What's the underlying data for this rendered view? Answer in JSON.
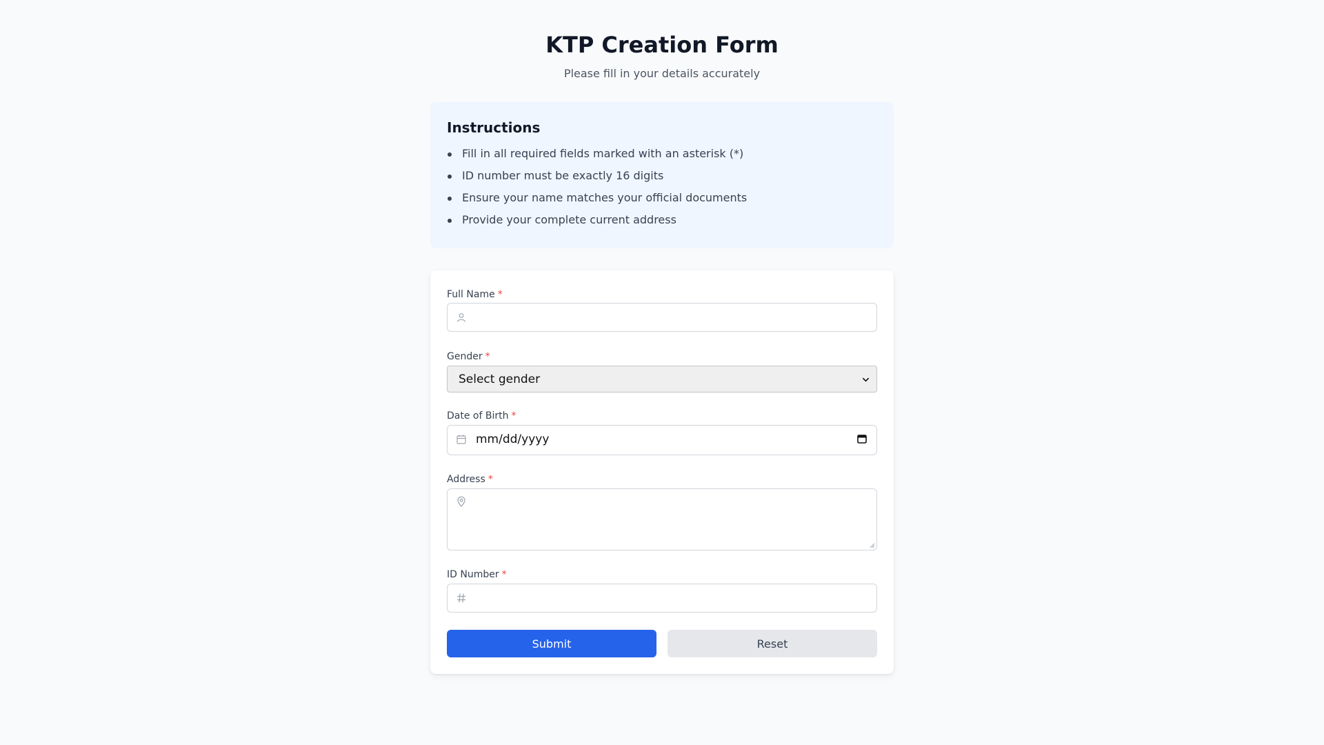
{
  "header": {
    "title": "KTP Creation Form",
    "subtitle": "Please fill in your details accurately"
  },
  "instructions": {
    "heading": "Instructions",
    "items": [
      "Fill in all required fields marked with an asterisk (*)",
      "ID number must be exactly 16 digits",
      "Ensure your name matches your official documents",
      "Provide your complete current address"
    ]
  },
  "form": {
    "full_name": {
      "label": "Full Name",
      "required_mark": "*",
      "value": "",
      "icon": "user-icon"
    },
    "gender": {
      "label": "Gender",
      "required_mark": "*",
      "selected": "Select gender",
      "icon": "chevron-down-icon"
    },
    "date_of_birth": {
      "label": "Date of Birth",
      "required_mark": "*",
      "value": "mm/dd/yyyy",
      "icon": "calendar-icon"
    },
    "address": {
      "label": "Address",
      "required_mark": "*",
      "value": "",
      "icon": "map-pin-icon"
    },
    "id_number": {
      "label": "ID Number",
      "required_mark": "*",
      "value": "",
      "icon": "hash-icon"
    }
  },
  "buttons": {
    "submit_label": "Submit",
    "reset_label": "Reset"
  },
  "colors": {
    "primary": "#2563eb",
    "required": "#ef4444",
    "instructions_bg": "#eff6ff",
    "page_bg": "#f9fafb"
  }
}
